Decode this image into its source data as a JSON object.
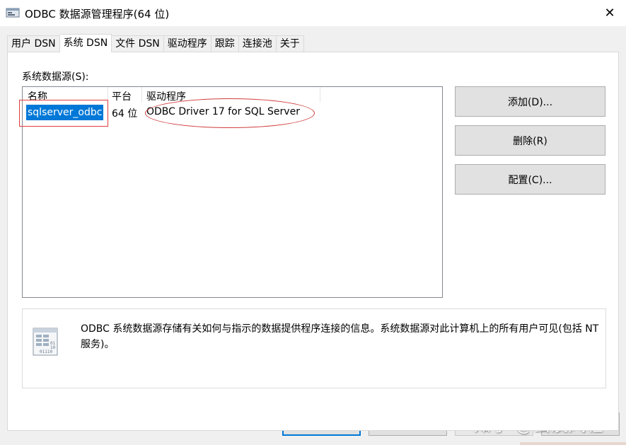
{
  "window": {
    "title": "ODBC 数据源管理程序(64 位)",
    "close_glyph": "✕"
  },
  "tabs": [
    {
      "label": "用户 DSN",
      "active": false
    },
    {
      "label": "系统 DSN",
      "active": true
    },
    {
      "label": "文件 DSN",
      "active": false
    },
    {
      "label": "驱动程序",
      "active": false
    },
    {
      "label": "跟踪",
      "active": false
    },
    {
      "label": "连接池",
      "active": false
    },
    {
      "label": "关于",
      "active": false
    }
  ],
  "system_dsn": {
    "label": "系统数据源(S):",
    "columns": [
      "名称",
      "平台",
      "驱动程序"
    ],
    "rows": [
      {
        "name": "sqlserver_odbc",
        "platform": "64 位",
        "driver": "ODBC Driver 17 for SQL Server",
        "selected": true
      }
    ]
  },
  "side_buttons": {
    "add": "添加(D)...",
    "remove": "删除(R)",
    "configure": "配置(C)..."
  },
  "info": {
    "icon": "database-doc-icon",
    "text": "ODBC 系统数据源存储有关如何与指示的数据提供程序连接的信息。系统数据源对此计算机上的所有用户可见(包括 NT 服务)。"
  },
  "bottom_buttons": {
    "ok": "确定",
    "cancel": "取消",
    "apply": "应用(A)",
    "help": "帮助"
  },
  "watermark": "知乎 @云淡风轻",
  "colors": {
    "selection": "#0078d7",
    "annotation_red": "#e03c3c",
    "panel_bg": "#ffffff",
    "dialog_bg": "#f0f0f0"
  }
}
